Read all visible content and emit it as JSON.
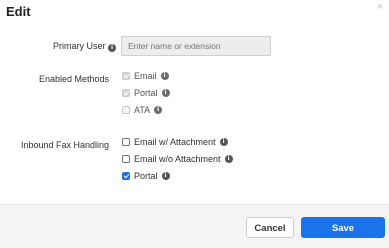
{
  "modal": {
    "title": "Edit",
    "close_glyph": "×"
  },
  "primary_user": {
    "label": "Primary User",
    "placeholder": "Enter name or extension",
    "value": ""
  },
  "enabled_methods": {
    "label": "Enabled Methods",
    "options": [
      {
        "label": "Email",
        "checked": true,
        "disabled": true
      },
      {
        "label": "Portal",
        "checked": true,
        "disabled": true
      },
      {
        "label": "ATA",
        "checked": false,
        "disabled": true
      }
    ]
  },
  "inbound_fax": {
    "label": "Inbound Fax Handling",
    "options": [
      {
        "label": "Email w/ Attachment",
        "checked": false
      },
      {
        "label": "Email w/o Attachment",
        "checked": false
      },
      {
        "label": "Portal",
        "checked": true
      }
    ]
  },
  "footer": {
    "cancel_label": "Cancel",
    "save_label": "Save"
  },
  "icons": {
    "info": "info-icon",
    "close": "close-icon"
  },
  "colors": {
    "accent": "#1a73e8",
    "footer_bg": "#f4f4f4"
  }
}
